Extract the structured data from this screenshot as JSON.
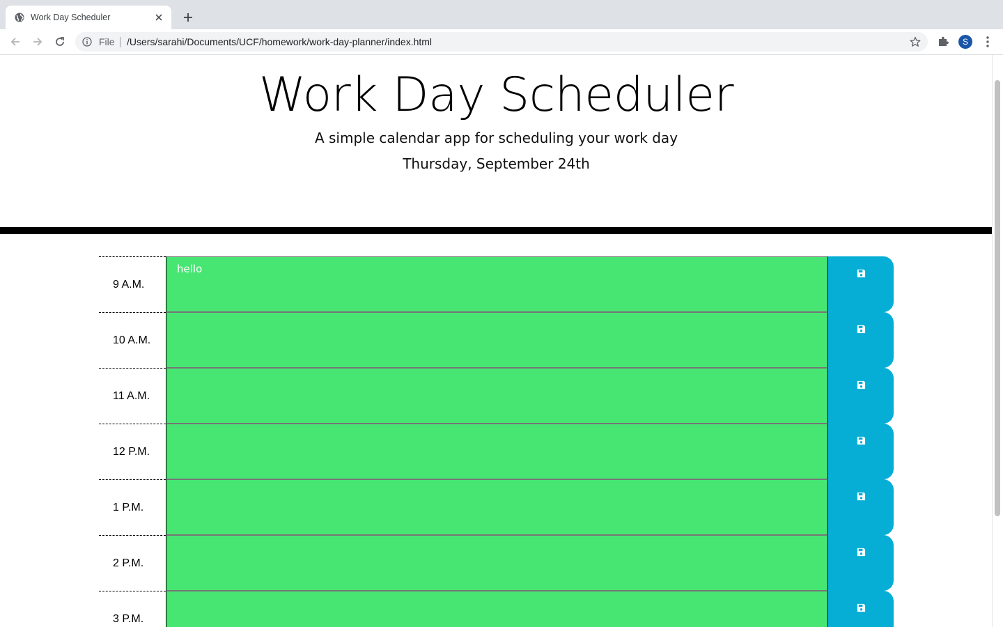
{
  "browser": {
    "tab_title": "Work Day Scheduler",
    "scheme_label": "File",
    "url": "/Users/sarahi/Documents/UCF/homework/work-day-planner/index.html",
    "profile_initial": "S"
  },
  "header": {
    "title": "Work Day Scheduler",
    "lead": "A simple calendar app for scheduling your work day",
    "current_day": "Thursday, September 24th"
  },
  "schedule": {
    "rows": [
      {
        "hour": "9 A.M.",
        "text": "hello"
      },
      {
        "hour": "10 A.M.",
        "text": ""
      },
      {
        "hour": "11 A.M.",
        "text": ""
      },
      {
        "hour": "12 P.M.",
        "text": ""
      },
      {
        "hour": "1 P.M.",
        "text": ""
      },
      {
        "hour": "2 P.M.",
        "text": ""
      },
      {
        "hour": "3 P.M.",
        "text": ""
      }
    ],
    "save_icon": "floppy-disk-icon"
  },
  "colors": {
    "future": "#47e673",
    "save_button": "#06aed5",
    "divider": "#000000"
  }
}
